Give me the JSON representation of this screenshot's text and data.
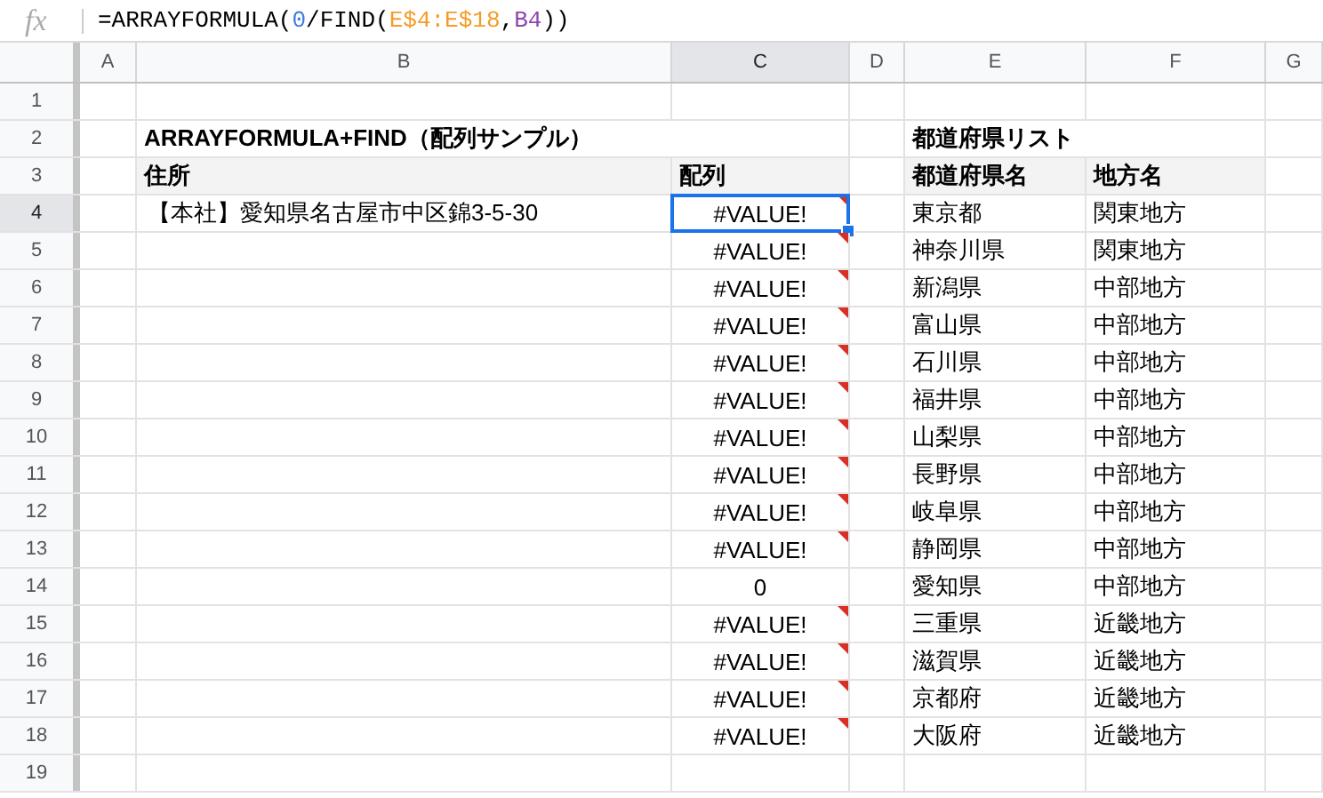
{
  "formula_bar": {
    "fx_label": "fx",
    "segments": [
      {
        "text": "=ARRAYFORMULA(",
        "color": "#000000"
      },
      {
        "text": "0",
        "color": "#3d7ee0"
      },
      {
        "text": "/FIND(",
        "color": "#000000"
      },
      {
        "text": "E$4:E$18",
        "color": "#f39c26"
      },
      {
        "text": ",",
        "color": "#000000"
      },
      {
        "text": "B4",
        "color": "#8e44ad"
      },
      {
        "text": "))",
        "color": "#000000"
      }
    ]
  },
  "columns": [
    {
      "label": "A",
      "selected": false
    },
    {
      "label": "B",
      "selected": false
    },
    {
      "label": "C",
      "selected": true
    },
    {
      "label": "D",
      "selected": false
    },
    {
      "label": "E",
      "selected": false
    },
    {
      "label": "F",
      "selected": false
    },
    {
      "label": "G",
      "selected": false
    }
  ],
  "rows": [
    {
      "number": "1",
      "selected": false,
      "kind": "blank"
    },
    {
      "number": "2",
      "selected": false,
      "kind": "title",
      "B": {
        "text": "ARRAYFORMULA+FIND（配列サンプル）"
      },
      "E": {
        "text": "都道府県リスト"
      }
    },
    {
      "number": "3",
      "selected": false,
      "kind": "header",
      "B": {
        "text": "住所"
      },
      "C": {
        "text": "配列"
      },
      "E": {
        "text": "都道府県名"
      },
      "F": {
        "text": "地方名"
      }
    },
    {
      "number": "4",
      "selected": true,
      "kind": "data",
      "B": {
        "text": "【本社】愛知県名古屋市中区錦3-5-30"
      },
      "C": {
        "text": "#VALUE!",
        "error": true,
        "selected": true
      },
      "E": {
        "text": "東京都"
      },
      "F": {
        "text": "関東地方"
      }
    },
    {
      "number": "5",
      "selected": false,
      "kind": "data",
      "C": {
        "text": "#VALUE!",
        "error": true,
        "selected": false
      },
      "E": {
        "text": "神奈川県"
      },
      "F": {
        "text": "関東地方"
      }
    },
    {
      "number": "6",
      "selected": false,
      "kind": "data",
      "C": {
        "text": "#VALUE!",
        "error": true,
        "selected": false
      },
      "E": {
        "text": "新潟県"
      },
      "F": {
        "text": "中部地方"
      }
    },
    {
      "number": "7",
      "selected": false,
      "kind": "data",
      "C": {
        "text": "#VALUE!",
        "error": true,
        "selected": false
      },
      "E": {
        "text": "富山県"
      },
      "F": {
        "text": "中部地方"
      }
    },
    {
      "number": "8",
      "selected": false,
      "kind": "data",
      "C": {
        "text": "#VALUE!",
        "error": true,
        "selected": false
      },
      "E": {
        "text": "石川県"
      },
      "F": {
        "text": "中部地方"
      }
    },
    {
      "number": "9",
      "selected": false,
      "kind": "data",
      "C": {
        "text": "#VALUE!",
        "error": true,
        "selected": false
      },
      "E": {
        "text": "福井県"
      },
      "F": {
        "text": "中部地方"
      }
    },
    {
      "number": "10",
      "selected": false,
      "kind": "data",
      "C": {
        "text": "#VALUE!",
        "error": true,
        "selected": false
      },
      "E": {
        "text": "山梨県"
      },
      "F": {
        "text": "中部地方"
      }
    },
    {
      "number": "11",
      "selected": false,
      "kind": "data",
      "C": {
        "text": "#VALUE!",
        "error": true,
        "selected": false
      },
      "E": {
        "text": "長野県"
      },
      "F": {
        "text": "中部地方"
      }
    },
    {
      "number": "12",
      "selected": false,
      "kind": "data",
      "C": {
        "text": "#VALUE!",
        "error": true,
        "selected": false
      },
      "E": {
        "text": "岐阜県"
      },
      "F": {
        "text": "中部地方"
      }
    },
    {
      "number": "13",
      "selected": false,
      "kind": "data",
      "C": {
        "text": "#VALUE!",
        "error": true,
        "selected": false
      },
      "E": {
        "text": "静岡県"
      },
      "F": {
        "text": "中部地方"
      }
    },
    {
      "number": "14",
      "selected": false,
      "kind": "data",
      "C": {
        "text": "0",
        "error": false,
        "selected": false
      },
      "E": {
        "text": "愛知県"
      },
      "F": {
        "text": "中部地方"
      }
    },
    {
      "number": "15",
      "selected": false,
      "kind": "data",
      "C": {
        "text": "#VALUE!",
        "error": true,
        "selected": false
      },
      "E": {
        "text": "三重県"
      },
      "F": {
        "text": "近畿地方"
      }
    },
    {
      "number": "16",
      "selected": false,
      "kind": "data",
      "C": {
        "text": "#VALUE!",
        "error": true,
        "selected": false
      },
      "E": {
        "text": "滋賀県"
      },
      "F": {
        "text": "近畿地方"
      }
    },
    {
      "number": "17",
      "selected": false,
      "kind": "data",
      "C": {
        "text": "#VALUE!",
        "error": true,
        "selected": false
      },
      "E": {
        "text": "京都府"
      },
      "F": {
        "text": "近畿地方"
      }
    },
    {
      "number": "18",
      "selected": false,
      "kind": "data",
      "C": {
        "text": "#VALUE!",
        "error": true,
        "selected": false
      },
      "E": {
        "text": "大阪府"
      },
      "F": {
        "text": "近畿地方"
      }
    },
    {
      "number": "19",
      "selected": false,
      "kind": "blank"
    }
  ]
}
